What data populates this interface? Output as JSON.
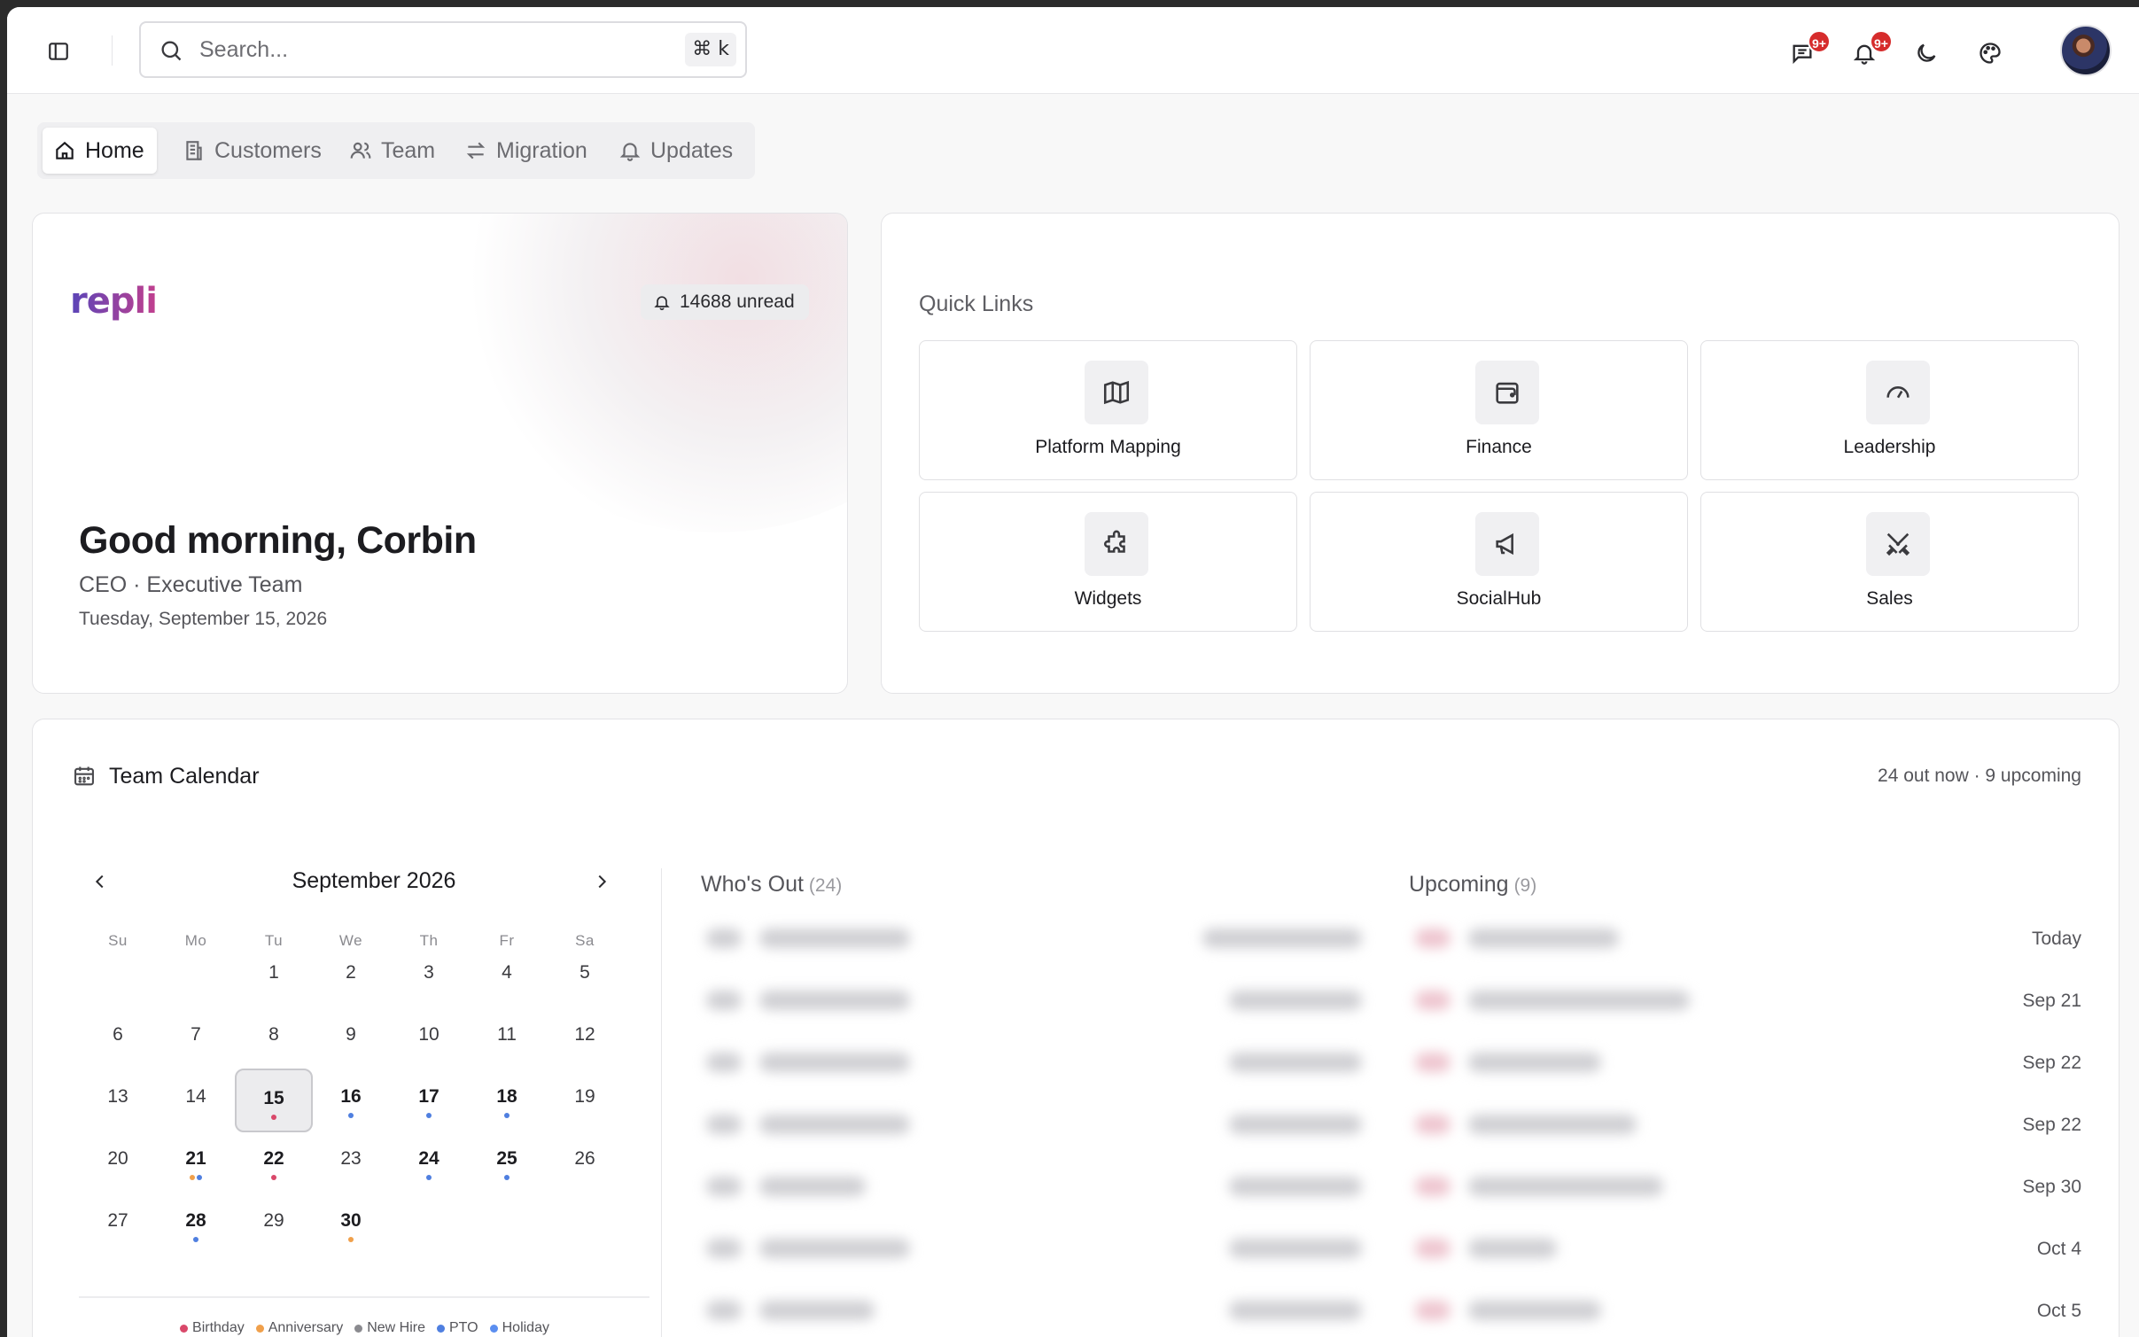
{
  "search": {
    "placeholder": "Search...",
    "shortcut": "⌘ k"
  },
  "topbar": {
    "messages_badge": "9+",
    "notifications_badge": "9+"
  },
  "tabs": [
    {
      "label": "Home",
      "icon": "home-icon",
      "active": true
    },
    {
      "label": "Customers",
      "icon": "building-icon",
      "active": false
    },
    {
      "label": "Team",
      "icon": "users-icon",
      "active": false
    },
    {
      "label": "Migration",
      "icon": "arrows-swap-icon",
      "active": false
    },
    {
      "label": "Updates",
      "icon": "bell-icon",
      "active": false
    }
  ],
  "hero": {
    "logo_text": "repli",
    "unread": "14688 unread",
    "greeting": "Good morning, Corbin",
    "role": "CEO · Executive Team",
    "date": "Tuesday, September 15, 2026"
  },
  "quick_links": {
    "title": "Quick Links",
    "items": [
      {
        "label": "Platform Mapping",
        "icon": "map-icon"
      },
      {
        "label": "Finance",
        "icon": "wallet-icon"
      },
      {
        "label": "Leadership",
        "icon": "gauge-icon"
      },
      {
        "label": "Widgets",
        "icon": "puzzle-icon"
      },
      {
        "label": "SocialHub",
        "icon": "megaphone-icon"
      },
      {
        "label": "Sales",
        "icon": "swords-icon"
      }
    ]
  },
  "calendar": {
    "title": "Team Calendar",
    "summary": "24 out now · 9 upcoming",
    "month": "September 2026",
    "weekdays": [
      "Su",
      "Mo",
      "Tu",
      "We",
      "Th",
      "Fr",
      "Sa"
    ],
    "selected_day": "15",
    "legend": [
      {
        "label": "Birthday",
        "color": "#d9486a"
      },
      {
        "label": "Anniversary",
        "color": "#f0a04b"
      },
      {
        "label": "New Hire",
        "color": "#8a8a8f"
      },
      {
        "label": "PTO",
        "color": "#4f7fe0"
      },
      {
        "label": "Holiday",
        "color": "#5b8ef0"
      }
    ]
  },
  "whos_out": {
    "title": "Who's Out",
    "count": "(24)"
  },
  "upcoming": {
    "title": "Upcoming",
    "count": "(9)",
    "dates": [
      "Today",
      "Sep 21",
      "Sep 22",
      "Sep 22",
      "Sep 30",
      "Oct 4",
      "Oct 5"
    ]
  }
}
